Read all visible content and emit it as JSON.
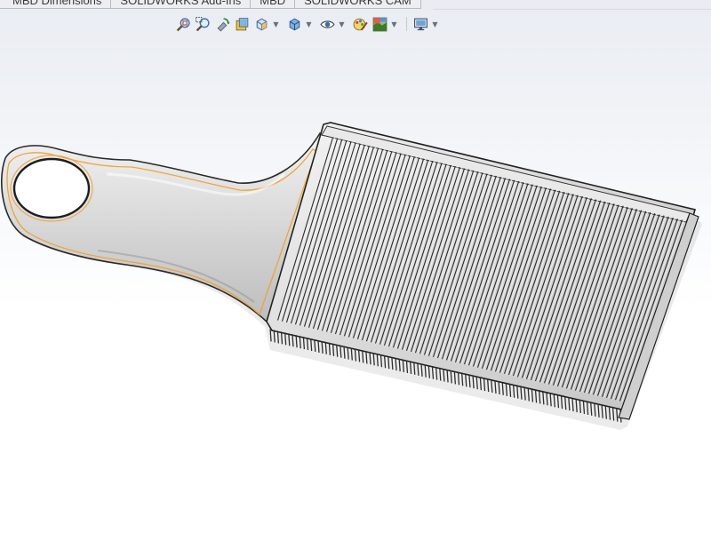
{
  "command_manager": {
    "tabs": [
      {
        "label": "MBD Dimensions"
      },
      {
        "label": "SOLIDWORKS Add-Ins"
      },
      {
        "label": "MBD"
      },
      {
        "label": "SOLIDWORKS CAM"
      }
    ]
  },
  "heads_up_toolbar": {
    "buttons": [
      {
        "icon": "zoom-to-fit-icon"
      },
      {
        "icon": "zoom-to-area-icon"
      },
      {
        "icon": "previous-view-icon"
      },
      {
        "icon": "section-view-icon"
      },
      {
        "icon": "view-orientation-icon",
        "dropdown": true
      },
      {
        "icon": "display-style-icon",
        "dropdown": true
      },
      {
        "icon": "hide-show-items-icon",
        "dropdown": true
      },
      {
        "icon": "edit-appearance-icon"
      },
      {
        "icon": "apply-scene-icon",
        "dropdown": true
      },
      {
        "icon": "view-settings-icon",
        "dropdown": true
      }
    ]
  },
  "graphics_area": {
    "model": "comb-part",
    "colors": {
      "background_top": "#e9ecf2",
      "background_bottom": "#ffffff",
      "model_body": "#d9d9d9",
      "model_edges": "#1a1a1a",
      "selection_highlight": "#f0a030"
    }
  }
}
